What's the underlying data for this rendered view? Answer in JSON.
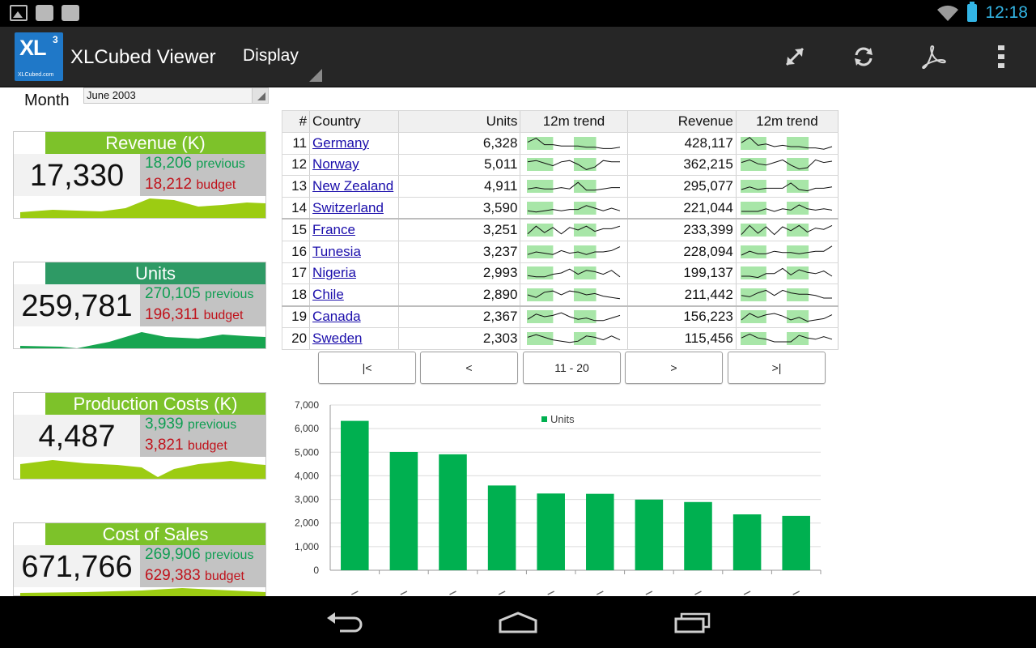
{
  "status_bar": {
    "time": "12:18"
  },
  "action_bar": {
    "logo_text": "XL",
    "logo_sup": "3",
    "logo_domain": "XLCubed.com",
    "title": "XLCubed Viewer",
    "display_label": "Display"
  },
  "filter": {
    "month_label": "Month",
    "month_value": "June 2003"
  },
  "kpis": [
    {
      "title": "Revenue (K)",
      "value": "17,330",
      "previous": "18,206",
      "budget": "18,212",
      "previous_label": "previous",
      "budget_label": "budget",
      "head_color": "#7dc22a",
      "spark_color": "#9ccc12"
    },
    {
      "title": "Units",
      "value": "259,781",
      "previous": "270,105",
      "budget": "196,311",
      "previous_label": "previous",
      "budget_label": "budget",
      "head_color": "#2e9a65",
      "spark_color": "#17a550"
    },
    {
      "title": "Production Costs (K)",
      "value": "4,487",
      "previous": "3,939",
      "budget": "3,821",
      "previous_label": "previous",
      "budget_label": "budget",
      "head_color": "#7dc22a",
      "spark_color": "#9ccc12"
    },
    {
      "title": "Cost of Sales",
      "value": "671,766",
      "previous": "269,906",
      "budget": "629,383",
      "previous_label": "previous",
      "budget_label": "budget",
      "head_color": "#7dc22a",
      "spark_color": "#9ccc12"
    }
  ],
  "table": {
    "headers": {
      "num": "#",
      "country": "Country",
      "units": "Units",
      "trend": "12m trend",
      "revenue": "Revenue",
      "trend2": "12m trend"
    },
    "rows": [
      {
        "num": "11",
        "country": "Germany",
        "units": "6,328",
        "revenue": "428,117"
      },
      {
        "num": "12",
        "country": "Norway",
        "units": "5,011",
        "revenue": "362,215"
      },
      {
        "num": "13",
        "country": "New Zealand",
        "units": "4,911",
        "revenue": "295,077"
      },
      {
        "num": "14",
        "country": "Switzerland",
        "units": "3,590",
        "revenue": "221,044"
      },
      {
        "num": "15",
        "country": "France",
        "units": "3,251",
        "revenue": "233,399"
      },
      {
        "num": "16",
        "country": "Tunesia",
        "units": "3,237",
        "revenue": "228,094"
      },
      {
        "num": "17",
        "country": "Nigeria",
        "units": "2,993",
        "revenue": "199,137"
      },
      {
        "num": "18",
        "country": "Chile",
        "units": "2,890",
        "revenue": "211,442"
      },
      {
        "num": "19",
        "country": "Canada",
        "units": "2,367",
        "revenue": "156,223"
      },
      {
        "num": "20",
        "country": "Sweden",
        "units": "2,303",
        "revenue": "115,456"
      }
    ]
  },
  "pager": {
    "first": "|<",
    "prev": "<",
    "range": "11 - 20",
    "next": ">",
    "last": ">|"
  },
  "chart_data": {
    "type": "bar",
    "categories": [
      "",
      "",
      "",
      "",
      "",
      "",
      "",
      "",
      "",
      ""
    ],
    "series": [
      {
        "name": "Units",
        "values": [
          6328,
          5011,
          4911,
          3590,
          3251,
          3237,
          2993,
          2890,
          2367,
          2303
        ]
      }
    ],
    "ylim": [
      0,
      7000
    ],
    "yticks": [
      "0",
      "1,000",
      "2,000",
      "3,000",
      "4,000",
      "5,000",
      "6,000",
      "7,000"
    ],
    "grid": true,
    "legend": "top-center",
    "color": "#00b050"
  }
}
